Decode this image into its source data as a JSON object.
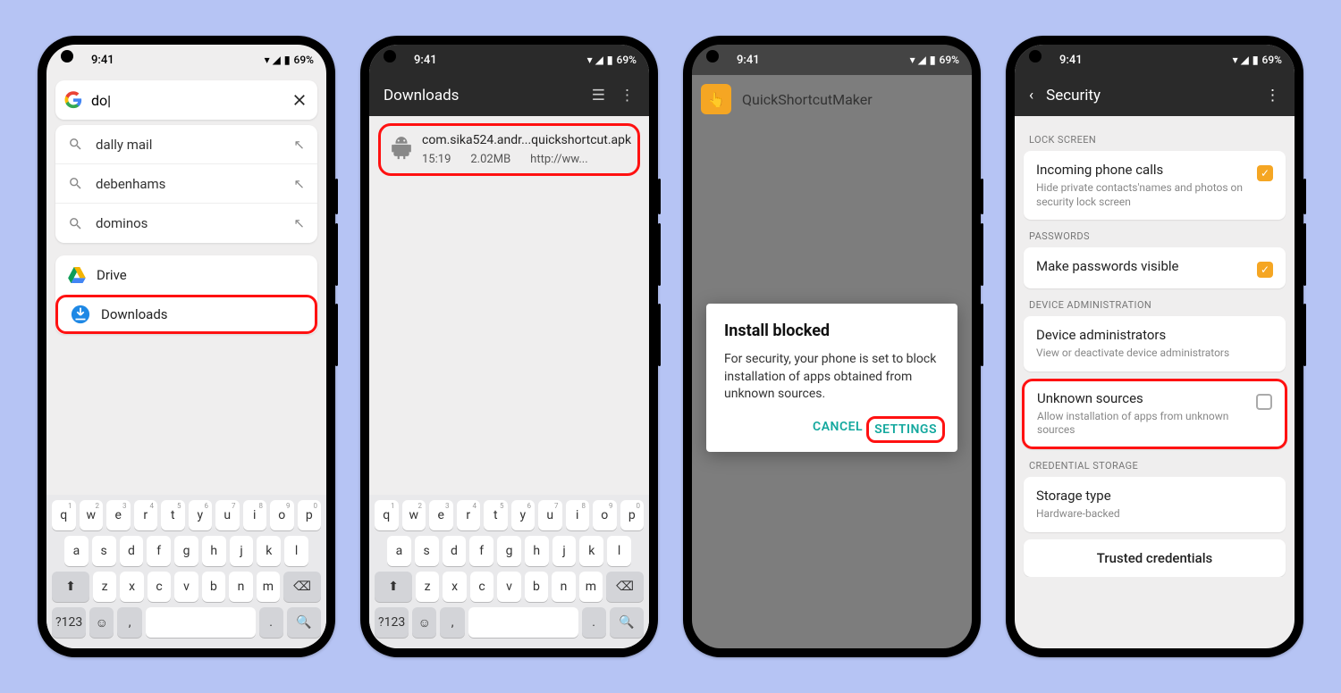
{
  "status": {
    "time": "9:41",
    "battery": "69%"
  },
  "phone1": {
    "search_value": "do|",
    "suggestions": [
      "dally mail",
      "debenhams",
      "dominos"
    ],
    "apps": [
      {
        "label": "Drive",
        "highlight": false
      },
      {
        "label": "Downloads",
        "highlight": true
      }
    ]
  },
  "phone2": {
    "title": "Downloads",
    "file": {
      "name": "com.sika524.andr...quickshortcut.apk",
      "time": "15:19",
      "size": "2.02MB",
      "source": "http://ww..."
    }
  },
  "phone3": {
    "app_title": "QuickShortcutMaker",
    "dialog": {
      "title": "Install blocked",
      "body": "For security, your phone is set to block installation of apps obtained from unknown sources.",
      "cancel": "CANCEL",
      "settings": "SETTINGS"
    }
  },
  "phone4": {
    "title": "Security",
    "cat_lock": "LOCK SCREEN",
    "incoming": {
      "title": "Incoming phone calls",
      "sub": "Hide private contacts'names and photos on security lock screen"
    },
    "cat_pw": "PASSWORDS",
    "pwvis": {
      "title": "Make passwords visible"
    },
    "cat_admin": "DEVICE ADMINISTRATION",
    "devadmin": {
      "title": "Device administrators",
      "sub": "View or deactivate device administrators"
    },
    "unknown": {
      "title": "Unknown sources",
      "sub": "Allow installation of apps from unknown sources"
    },
    "cat_cred": "CREDENTIAL STORAGE",
    "storage": {
      "title": "Storage type",
      "sub": "Hardware-backed"
    },
    "trusted": {
      "title": "Trusted credentials"
    }
  },
  "keyboard": {
    "r1": [
      "q",
      "w",
      "e",
      "r",
      "t",
      "y",
      "u",
      "i",
      "o",
      "p"
    ],
    "r2": [
      "a",
      "s",
      "d",
      "f",
      "g",
      "h",
      "j",
      "k",
      "l"
    ],
    "r3": [
      "z",
      "x",
      "c",
      "v",
      "b",
      "n",
      "m"
    ],
    "num": "?123"
  }
}
